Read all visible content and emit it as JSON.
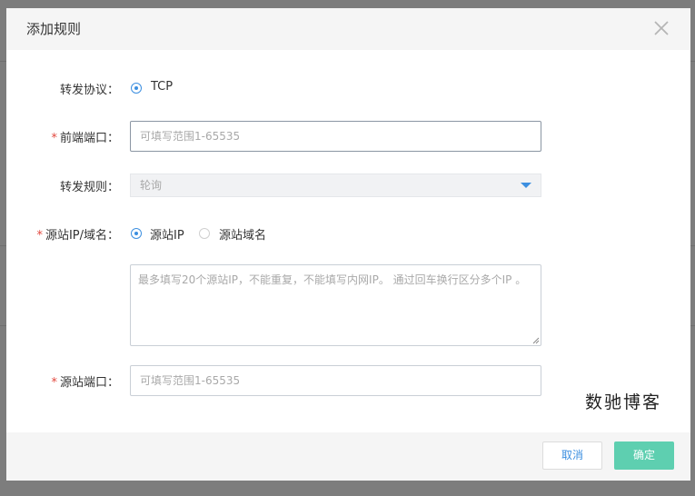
{
  "modal": {
    "title": "添加规则",
    "close_icon": "close-icon"
  },
  "form": {
    "protocol": {
      "label": "转发协议：",
      "option_label": "TCP",
      "selected": true
    },
    "frontend_port": {
      "label": "前端端口：",
      "required": true,
      "placeholder": "可填写范围1-65535",
      "value": ""
    },
    "forward_rule": {
      "label": "转发规则：",
      "selected_value": "轮询"
    },
    "origin": {
      "label": "源站IP/域名：",
      "required": true,
      "options": [
        {
          "label": "源站IP",
          "selected": true
        },
        {
          "label": "源站域名",
          "selected": false
        }
      ],
      "textarea_placeholder": "最多填写20个源站IP，不能重复，不能填写内网IP。 通过回车换行区分多个IP 。"
    },
    "origin_port": {
      "label": "源站端口：",
      "required": true,
      "placeholder": "可填写范围1-65535",
      "value": ""
    },
    "required_mark": "*"
  },
  "watermark": "数驰博客",
  "footer": {
    "cancel_label": "取消",
    "ok_label": "确定"
  },
  "colors": {
    "accent": "#3c8fe0",
    "ok_button": "#5ecfb0",
    "required": "#e2483e",
    "overlay": "#7d7d7d"
  }
}
